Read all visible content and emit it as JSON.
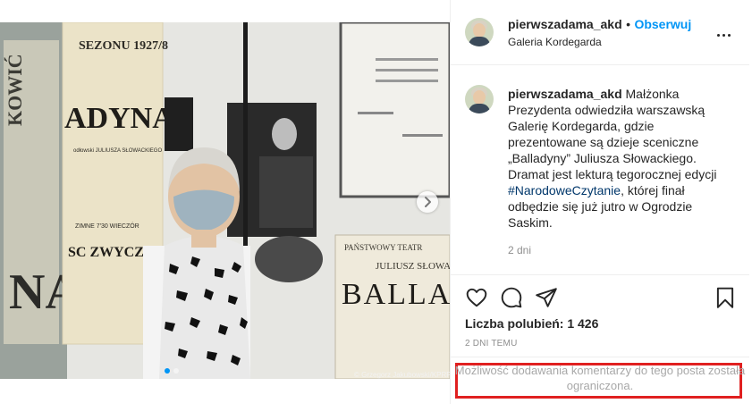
{
  "post": {
    "username": "pierwszadama_akd",
    "follow_label": "Obserwuj",
    "separator": "•",
    "location": "Galeria Kordegarda",
    "caption_before_tag": "Małżonka Prezydenta odwiedziła warszawską Galerię Kordegarda, gdzie prezentowane są dzieje sceniczne „Balladyny” Juliusza Słowackiego. Dramat jest lekturą tegorocznej edycji ",
    "hashtag": "#NarodoweCzytanie",
    "caption_after_tag": ", której finał odbędzie się już jutro w Ogrodzie Saskim.",
    "caption_time": "2 dni",
    "likes": "Liczba polubień: 1 426",
    "posted_ago": "2 DNI TEMU",
    "comments_limited": "Możliwość dodawania komentarzy do tego posta została ograniczona.",
    "photo_credit": "© Grzegorz Jakubowski/KPRP",
    "highlight_color": "#e02020",
    "accent_color": "#0095f6"
  },
  "photo": {
    "poster_left_lines": [
      "SEZONU 1927/8",
      "ADYNA",
      "odłowski JULIUSZA SŁOWACKIEGO",
      "ZIMNE 7'30 WIECZÓR",
      "SC ZWYCZAJNE"
    ],
    "poster_right_lines": [
      "PAŃSTWOWY TEATR",
      "JULIUSZ SŁOWACKI",
      "BALLAD"
    ],
    "left_edge_text": [
      "KOWIĆ",
      "NA"
    ]
  },
  "icons": {
    "like": "heart-icon",
    "comment": "comment-icon",
    "share": "share-icon",
    "save": "bookmark-icon",
    "more": "more-options-icon",
    "next": "chevron-right-icon"
  }
}
